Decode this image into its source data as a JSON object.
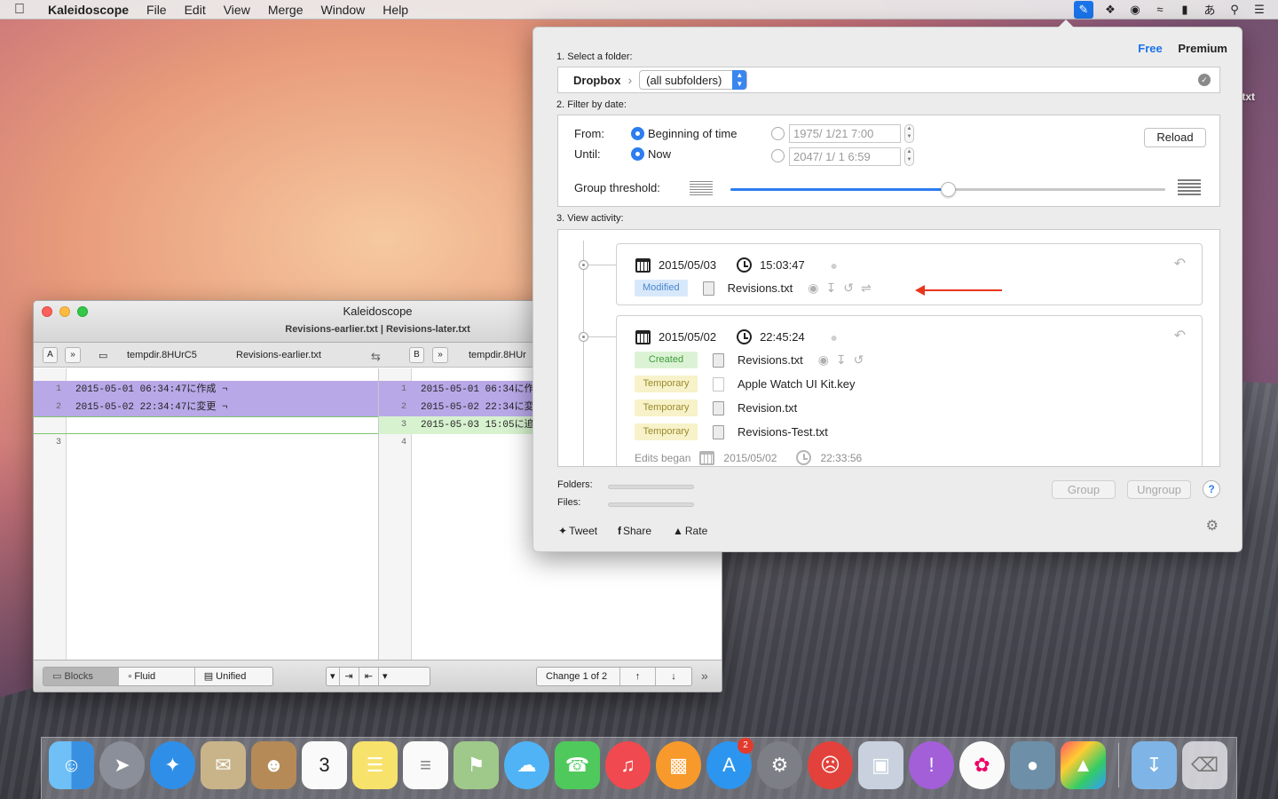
{
  "menubar": {
    "app_name": "Kaleidoscope",
    "items": [
      "File",
      "Edit",
      "View",
      "Merge",
      "Window",
      "Help"
    ],
    "status_icons": [
      "kaleidoscope-menu-icon",
      "dropbox-icon",
      "dash-icon",
      "wifi-icon",
      "battery-icon",
      "input-method-icon",
      "spotlight-icon",
      "notification-center-icon"
    ]
  },
  "desktop": {
    "file_ext": ".txt"
  },
  "panel": {
    "plan_free": "Free",
    "plan_premium": "Premium",
    "section1": "1. Select a folder:",
    "folder_root": "Dropbox",
    "subfolder_select": "(all subfolders)",
    "section2": "2. Filter by date:",
    "from_label": "From:",
    "until_label": "Until:",
    "from_option": "Beginning of time",
    "until_option": "Now",
    "from_date": "1975/  1/21   7:00",
    "until_date": "2047/  1/  1   6:59",
    "reload": "Reload",
    "group_threshold_label": "Group threshold:",
    "group_threshold_value": 0.5,
    "section3": "3. View activity:",
    "groups": [
      {
        "date": "2015/05/03",
        "time": "15:03:47",
        "entries": [
          {
            "badge": "Modified",
            "file": "Revisions.txt"
          }
        ]
      },
      {
        "date": "2015/05/02",
        "time": "22:45:24",
        "entries": [
          {
            "badge": "Created",
            "file": "Revisions.txt"
          },
          {
            "badge": "Temporary",
            "file": "Apple Watch UI Kit.key"
          },
          {
            "badge": "Temporary",
            "file": "Revision.txt"
          },
          {
            "badge": "Temporary",
            "file": "Revisions-Test.txt"
          }
        ],
        "edits_began_label": "Edits began",
        "edits_began_date": "2015/05/02",
        "edits_began_time": "22:33:56"
      }
    ],
    "folders_label": "Folders:",
    "files_label": "Files:",
    "group_btn": "Group",
    "ungroup_btn": "Ungroup",
    "help": "?",
    "tweet": "Tweet",
    "share": "Share",
    "rate": "Rate",
    "colors": {
      "accent": "#2b7df0",
      "arrow": "#e8361d"
    }
  },
  "kwin": {
    "title": "Kaleidoscope",
    "subtitle": "Revisions-earlier.txt | Revisions-later.txt",
    "left_label": "A",
    "right_label": "B",
    "left_folder": "tempdir.8HUrC5",
    "left_file": "Revisions-earlier.txt",
    "right_folder": "tempdir.8HUr",
    "left_lines": [
      {
        "num": "1",
        "text": "2015-05-01 06:34:47に作成 ¬"
      },
      {
        "num": "2",
        "text": "2015-05-02 22:34:47に変更 ¬"
      },
      {
        "num": "",
        "text": ""
      },
      {
        "num": "3",
        "text": ""
      }
    ],
    "right_lines": [
      {
        "num": "1",
        "text": "2015-05-01 06:34に作"
      },
      {
        "num": "2",
        "text": "2015-05-02 22:34に変"
      },
      {
        "num": "3",
        "text": "2015-05-03 15:05に追"
      },
      {
        "num": "4",
        "text": ""
      }
    ],
    "view_blocks": "Blocks",
    "view_fluid": "Fluid",
    "view_unified": "Unified",
    "change_counter": "Change 1 of 2"
  },
  "dock": {
    "items": [
      "Finder",
      "Launchpad",
      "Safari",
      "Mail",
      "Contacts",
      "Calendar",
      "Notes",
      "Reminders",
      "Maps",
      "Messages",
      "FaceTime",
      "iTunes",
      "iBooks",
      "App Store",
      "System Preferences",
      "App",
      "Preview",
      "Feedback",
      "Photos",
      "Image Capture",
      "Kaleidoscope"
    ],
    "calendar_day": "3",
    "appstore_badge": "2",
    "downloads": "Downloads",
    "trash": "Trash"
  }
}
